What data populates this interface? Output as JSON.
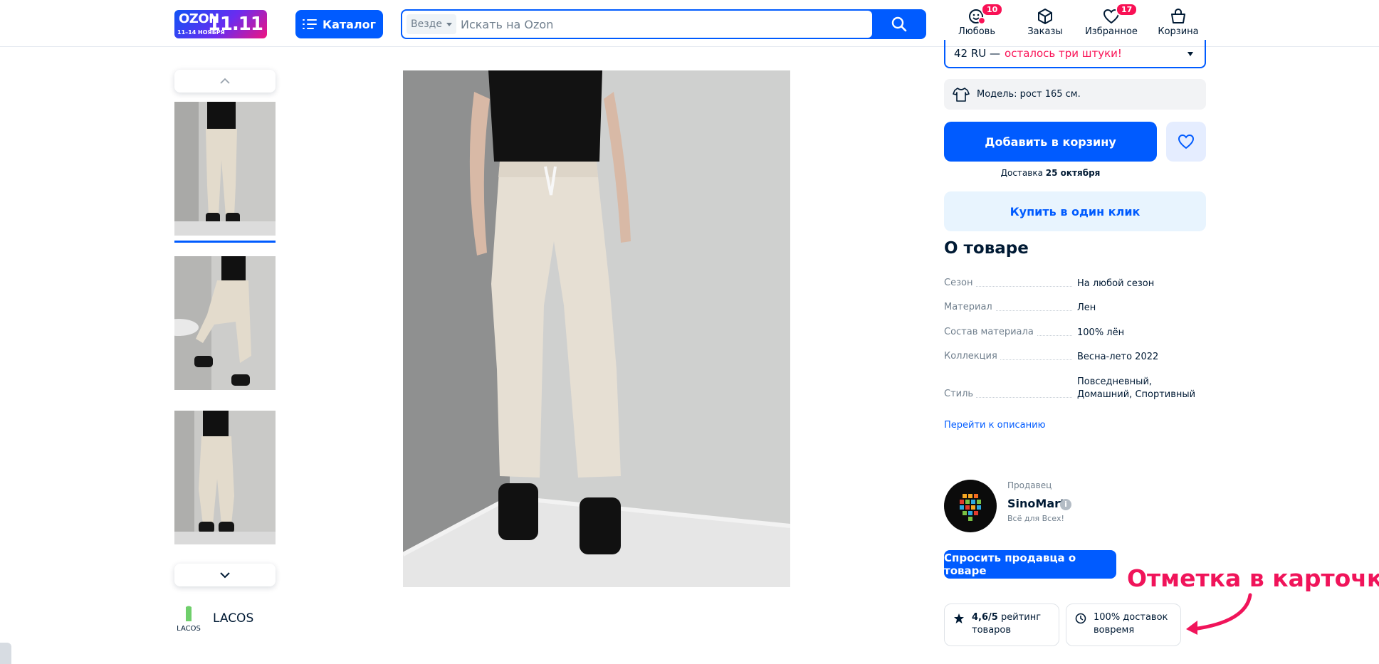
{
  "header": {
    "logo": {
      "brand": "OZON",
      "dates": "11–14 НОЯБРЯ",
      "sale": "11.11"
    },
    "catalog_label": "Каталог",
    "search": {
      "scope": "Везде",
      "placeholder": "Искать на Ozon"
    },
    "nav": [
      {
        "label": "Любовь",
        "badge": "10"
      },
      {
        "label": "Заказы"
      },
      {
        "label": "Избранное",
        "badge": "17"
      },
      {
        "label": "Корзина"
      }
    ]
  },
  "gallery": {
    "thumbnails": [
      "Фото 1",
      "Фото 2",
      "Фото 3"
    ],
    "active_index": 0
  },
  "brand": {
    "logo_text": "LACOS",
    "name": "LACOS"
  },
  "product": {
    "size": {
      "value": "42 RU —",
      "warning": "осталось три штуки!"
    },
    "model_info": "Модель: рост 165 см.",
    "add_to_cart": "Добавить в корзину",
    "delivery_prefix": "Доставка",
    "delivery_date": "25 октября",
    "buy_one_click": "Купить в один клик"
  },
  "about": {
    "title": "О товаре",
    "specs": [
      {
        "key": "Сезон",
        "value": "На любой сезон"
      },
      {
        "key": "Материал",
        "value": "Лен"
      },
      {
        "key": "Состав материала",
        "value": "100% лён"
      },
      {
        "key": "Коллекция",
        "value": "Весна-лето 2022"
      },
      {
        "key": "Стиль",
        "value": "Повседневный, Домашний, Спортивный"
      }
    ],
    "goto_description": "Перейти к описанию"
  },
  "seller": {
    "caption": "Продавец",
    "name": "SinoMart",
    "slogan": "Всё для Всех!",
    "ask_button": "Спросить продавца о товаре",
    "rating_value": "4,6/5",
    "rating_text": "рейтинг товаров",
    "ontime_text": "100% доставок вовремя"
  },
  "annotation": "Отметка в карточке",
  "colors": {
    "accent": "#005bff",
    "pink": "#f91155",
    "annotation": "#f0145a"
  }
}
